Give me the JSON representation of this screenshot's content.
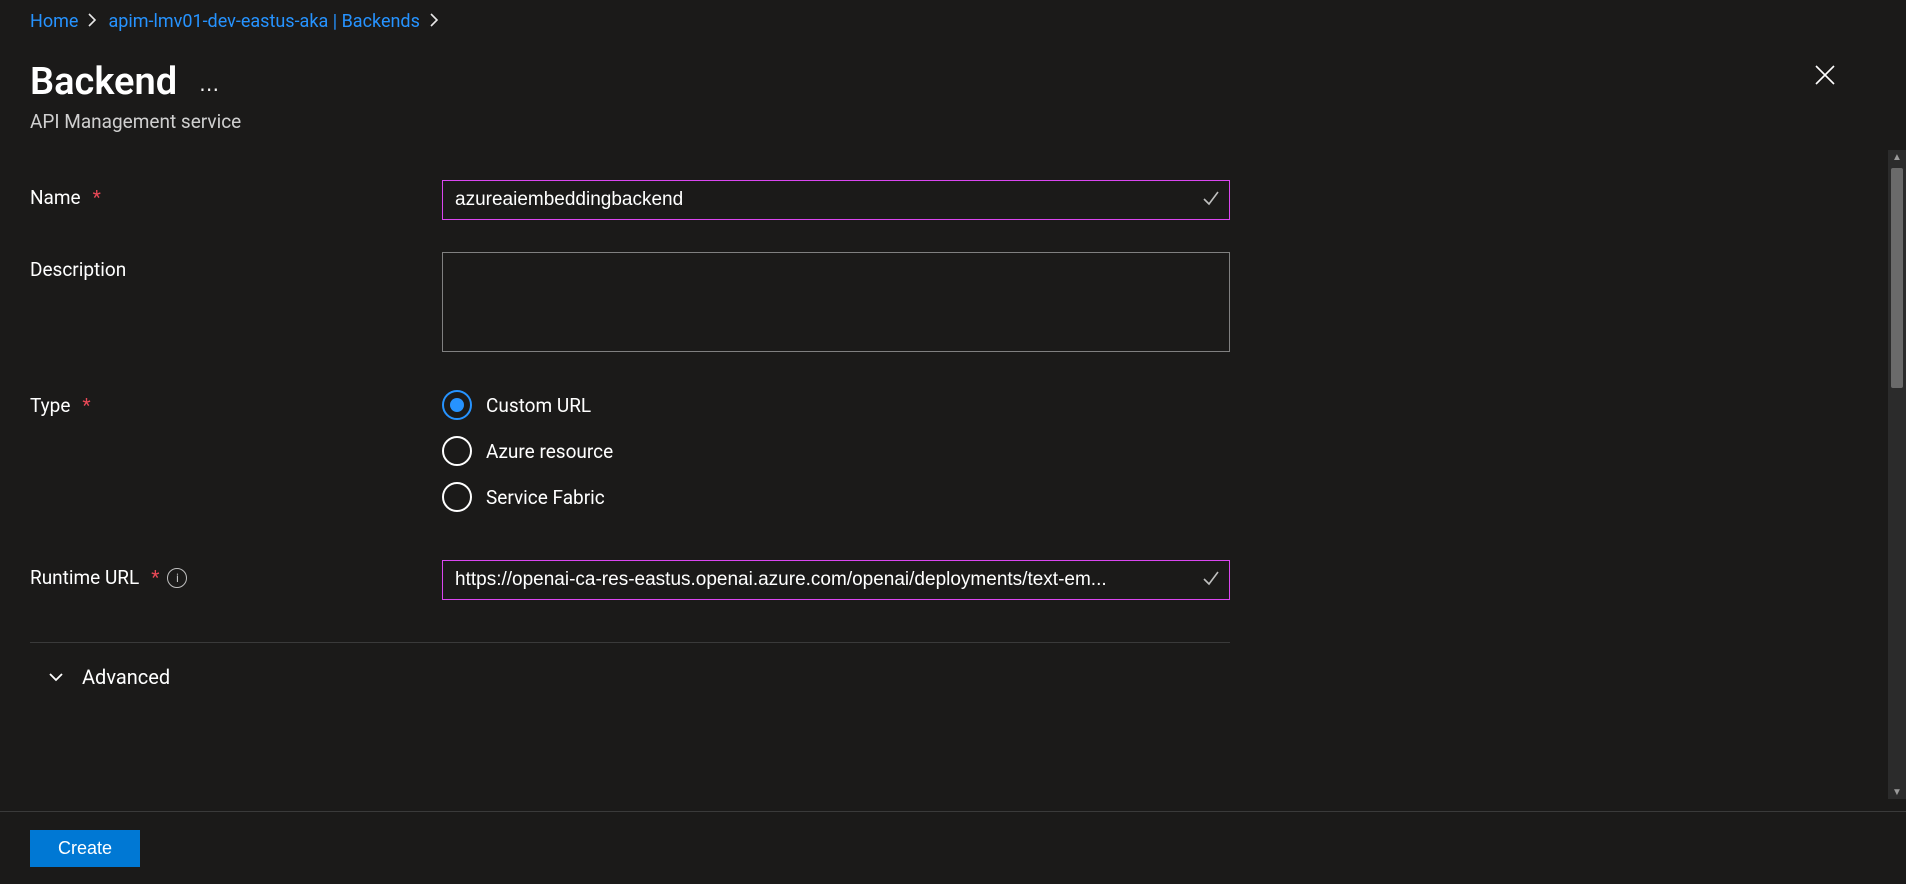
{
  "breadcrumb": {
    "home": "Home",
    "resource": "apim-lmv01-dev-eastus-aka | Backends"
  },
  "header": {
    "title": "Backend",
    "subtitle": "API Management service"
  },
  "form": {
    "name_label": "Name",
    "name_value": "azureaiembeddingbackend",
    "description_label": "Description",
    "description_value": "",
    "type_label": "Type",
    "type_options": {
      "custom_url": "Custom URL",
      "azure_resource": "Azure resource",
      "service_fabric": "Service Fabric"
    },
    "type_selected": "custom_url",
    "runtime_label": "Runtime URL",
    "runtime_value": "https://openai-ca-res-eastus.openai.azure.com/openai/deployments/text-em..."
  },
  "advanced_label": "Advanced",
  "footer": {
    "create_label": "Create"
  }
}
